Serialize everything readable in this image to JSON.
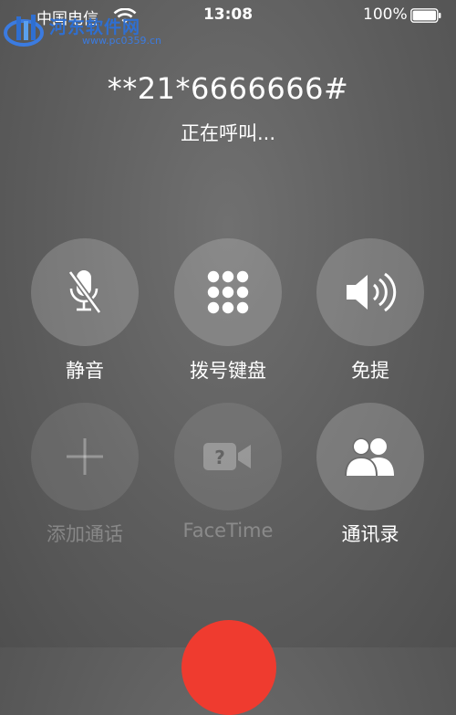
{
  "status_bar": {
    "carrier": "中国电信",
    "time": "13:08",
    "battery_percent": "100%",
    "battery_level": 1.0
  },
  "watermark": {
    "title": "河东软件网",
    "url": "www.pc0359.cn"
  },
  "call": {
    "number": "**21*6666666#",
    "status": "正在呼叫..."
  },
  "controls": {
    "mute": {
      "label": "静音",
      "icon": "microphone-muted-icon",
      "enabled": true
    },
    "keypad": {
      "label": "拨号键盘",
      "icon": "keypad-icon",
      "enabled": true
    },
    "speaker": {
      "label": "免提",
      "icon": "speaker-icon",
      "enabled": true
    },
    "add_call": {
      "label": "添加通话",
      "icon": "plus-icon",
      "enabled": false
    },
    "facetime": {
      "label": "FaceTime",
      "icon": "facetime-icon",
      "enabled": false
    },
    "contacts": {
      "label": "通讯录",
      "icon": "contacts-icon",
      "enabled": true
    }
  },
  "colors": {
    "end_call": "#ef3b2f",
    "watermark_blue": "#2f6fd1"
  }
}
